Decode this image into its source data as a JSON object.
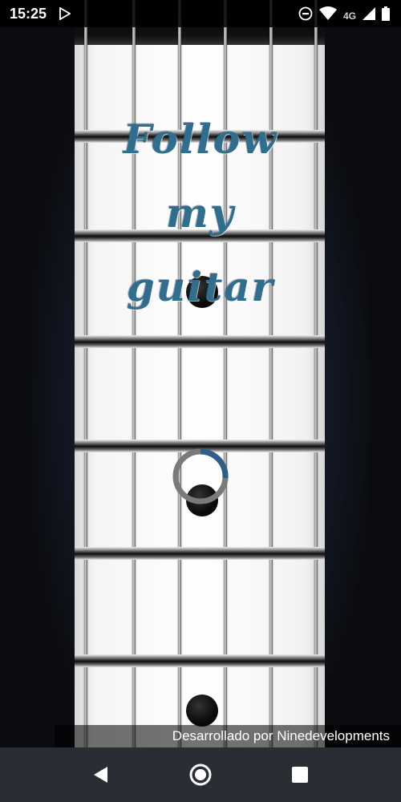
{
  "status_bar": {
    "time": "15:25",
    "network": "4G",
    "icons": [
      "play-store-icon",
      "do-not-disturb-icon",
      "wifi-icon",
      "signal-icon",
      "battery-icon"
    ]
  },
  "app": {
    "title_lines": [
      "Follow",
      "my",
      "guitar"
    ],
    "credit": "Desarrollado por Ninedevelopments",
    "colors": {
      "title": "#2f6e8c",
      "spinner_accent": "#2e5f8a",
      "spinner_track": "#7a7a7a"
    }
  },
  "navigation": {
    "icons": [
      "back-icon",
      "home-icon",
      "recents-icon"
    ]
  }
}
